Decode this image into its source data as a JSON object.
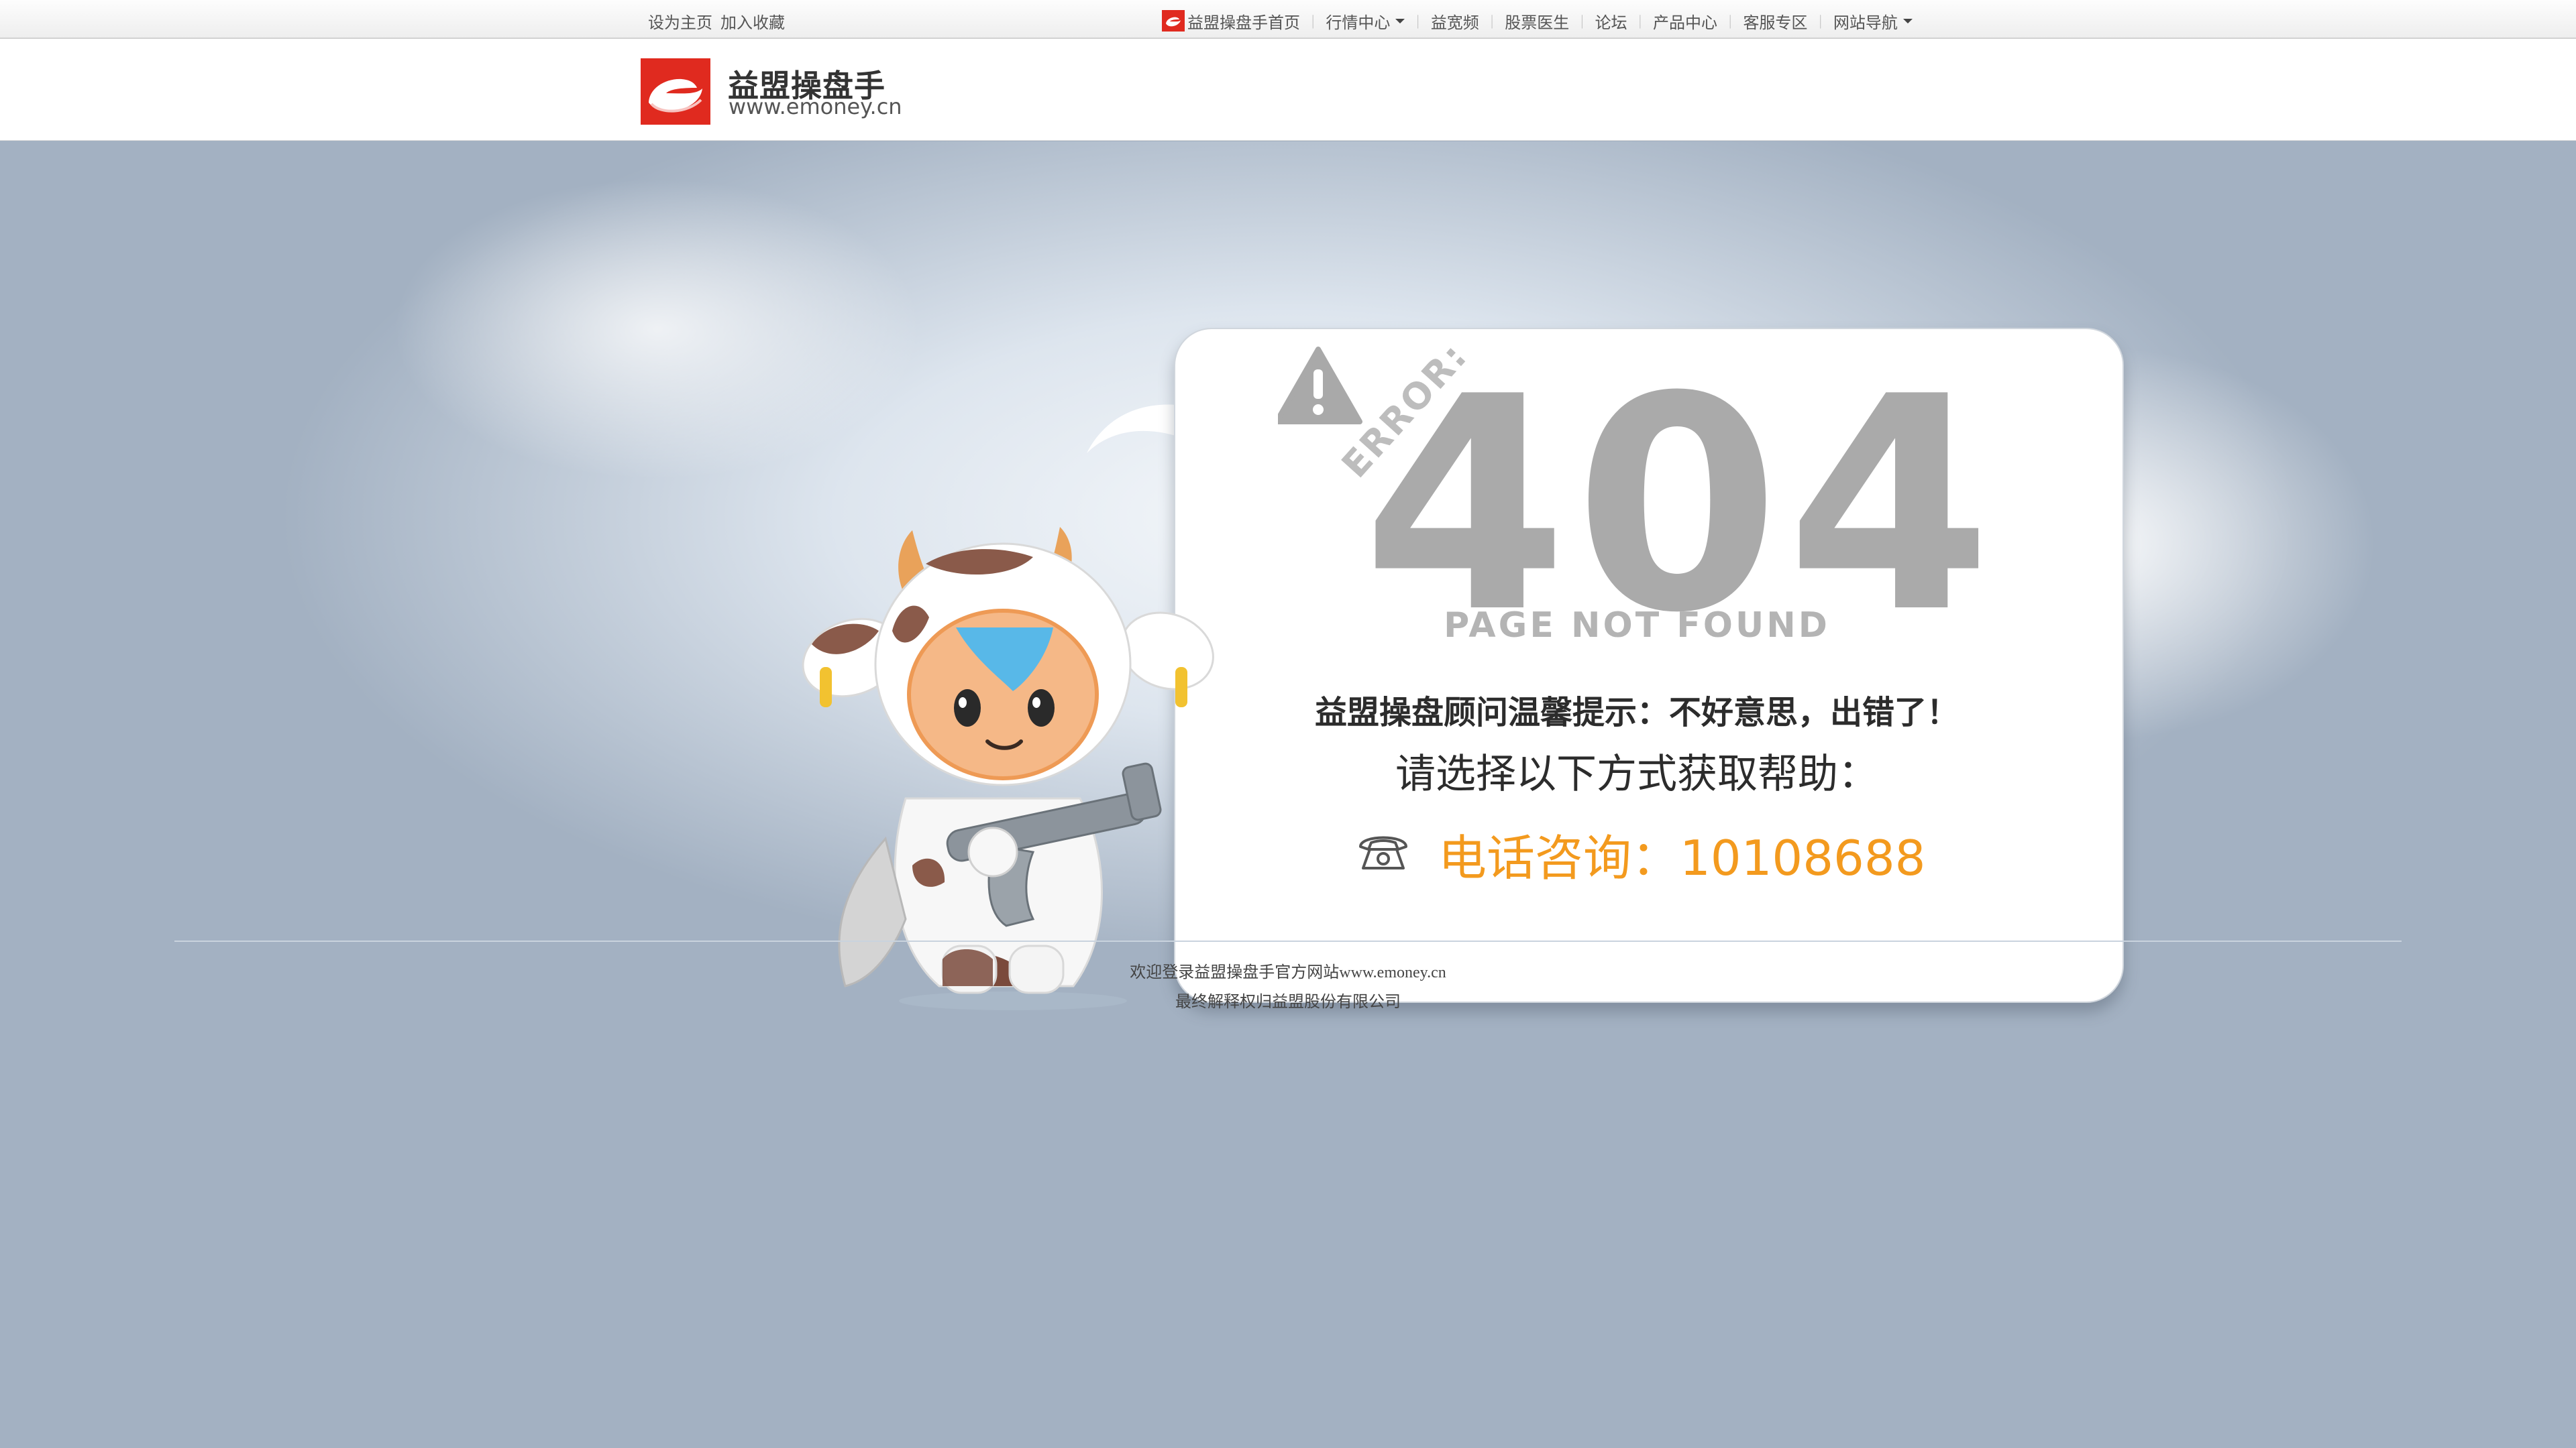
{
  "topbar": {
    "set_home": "设为主页",
    "add_favorite": "加入收藏",
    "nav": [
      {
        "label": "益盟操盘手首页"
      },
      {
        "label": "行情中心"
      },
      {
        "label": "益宽频"
      },
      {
        "label": "股票医生"
      },
      {
        "label": "论坛"
      },
      {
        "label": "产品中心"
      },
      {
        "label": "客服专区"
      },
      {
        "label": "网站导航"
      }
    ]
  },
  "header": {
    "brand_name": "益盟操盘手",
    "brand_url": "www.emoney.cn"
  },
  "error": {
    "prefix": "ERROR:",
    "code": "404",
    "subtitle": "PAGE NOT FOUND",
    "tip": "益盟操盘顾问温馨提示：不好意思，出错了！",
    "help": "请选择以下方式获取帮助：",
    "phone": "电话咨询：10108688"
  },
  "footer": {
    "line1": "欢迎登录益盟操盘手官方网站www.emoney.cn",
    "line2": "最终解释权归益盟股份有限公司"
  },
  "colors": {
    "page_background": "#a3b1c2",
    "brand_red": "#e02a1f",
    "phone_orange": "#f39a1e",
    "error_gray": "#aaaaaa"
  },
  "icons": [
    "emoney-logo-icon",
    "warning-icon",
    "telephone-icon",
    "caret-down-icon"
  ]
}
